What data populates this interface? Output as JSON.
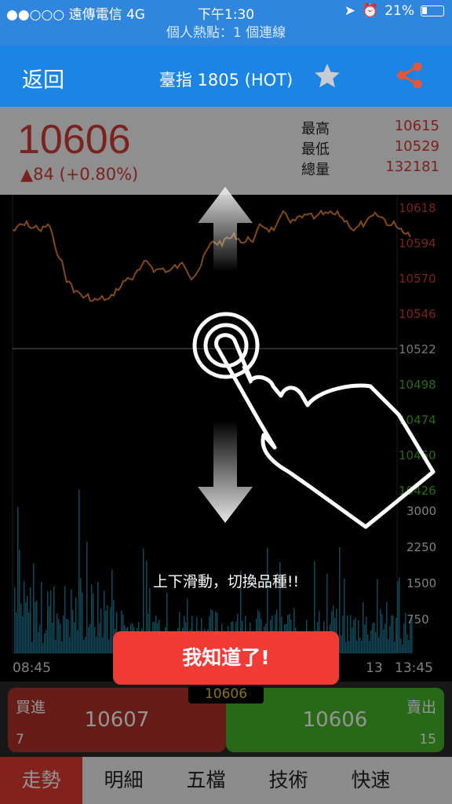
{
  "status_bar": {
    "carrier": "●●○○○ 遠傳電信",
    "network": "4G",
    "time": "下午1:30",
    "battery": "21%"
  },
  "hotspot": "個人熱點：1 個連線",
  "nav": {
    "back": "返回",
    "title": "臺指 1805 (HOT)"
  },
  "quote": {
    "price": "10606",
    "change": "▲84 (+0.80%)",
    "stats": [
      {
        "label": "最高",
        "value": "10615"
      },
      {
        "label": "最低",
        "value": "10529"
      },
      {
        "label": "總量",
        "value": "132181"
      }
    ]
  },
  "chart": {
    "price_ticks": [
      "10618",
      "10594",
      "10570",
      "10546",
      "10522",
      "10498",
      "10474",
      "10450",
      "10426"
    ],
    "volume_ticks": [
      "3000",
      "2250",
      "1500",
      "750"
    ],
    "time_labels": [
      "08:45",
      "13",
      "13:45"
    ]
  },
  "overlay": {
    "hint": "上下滑動，切換品種!!",
    "confirm": "我知道了!"
  },
  "trade": {
    "buy_label": "買進",
    "buy_price": "10607",
    "buy_qty": "7",
    "sell_label": "賣出",
    "sell_price": "10606",
    "sell_qty": "15",
    "last_price": "10606"
  },
  "tabs": [
    "走勢",
    "明細",
    "五檔",
    "技術",
    "快速"
  ],
  "colors": {
    "nav_blue": "#1c84e3",
    "up_red": "#d23b32",
    "down_green": "#45b62a",
    "confirm_red": "#f03b36"
  }
}
